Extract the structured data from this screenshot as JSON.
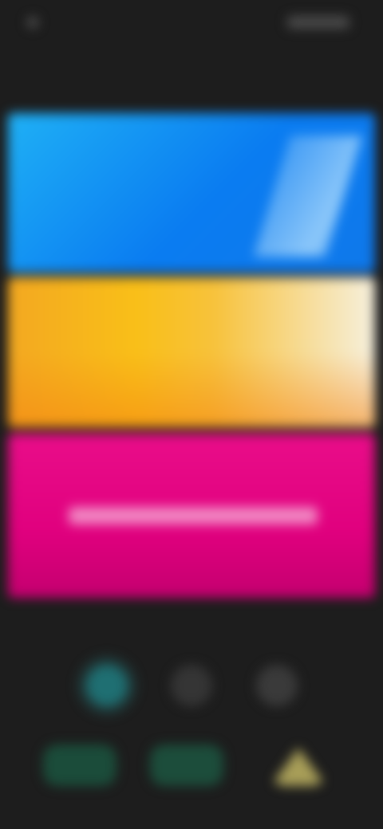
{
  "status_bar": {
    "time": "",
    "signal": ""
  },
  "header": {
    "title": ""
  },
  "cards": [
    {
      "title": "",
      "subtitle": ""
    },
    {
      "title": "",
      "subtitle": ""
    },
    {
      "label": ""
    }
  ],
  "dock": {
    "items": [
      {
        "icon": "app-icon-teal"
      },
      {
        "icon": "app-icon-gray"
      },
      {
        "icon": "app-icon-gray"
      }
    ]
  },
  "bottom_nav": {
    "items": [
      {
        "label": ""
      },
      {
        "label": ""
      },
      {
        "label": ""
      }
    ]
  },
  "colors": {
    "background": "#1d1d1d",
    "blue": "#0a7cf1",
    "yellow": "#f9bf18",
    "pink": "#e0007e",
    "teal": "#1f6f72",
    "green": "#1b4c3a",
    "gold": "#a89e58"
  }
}
